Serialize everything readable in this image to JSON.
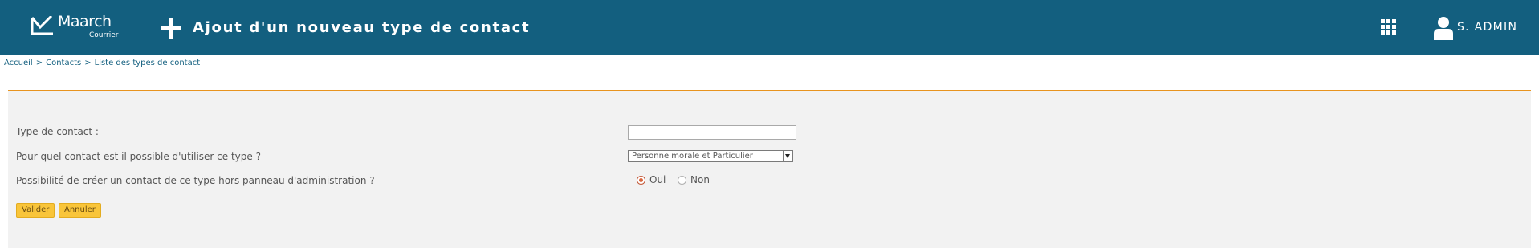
{
  "header": {
    "logo_name": "Maarch",
    "logo_sub": "Courrier",
    "page_title": "Ajout d'un nouveau type de contact",
    "user_name": "S. ADMIN",
    "icons": {
      "add": "plus-icon",
      "apps": "apps-grid-icon",
      "user": "user-icon"
    },
    "colors": {
      "background": "#135f7f",
      "text": "#ffffff"
    }
  },
  "breadcrumb": {
    "items": [
      "Accueil",
      "Contacts",
      "Liste des types de contact"
    ],
    "separator": ">"
  },
  "form": {
    "type_label": "Type de contact :",
    "type_value": "",
    "usage_label": "Pour quel contact est il possible d'utiliser ce type ?",
    "usage_value": "Personne morale et Particulier",
    "outside_admin_label": "Possibilité de créer un contact de ce type hors panneau d'administration ?",
    "outside_admin_options": [
      {
        "label": "Oui",
        "checked": true
      },
      {
        "label": "Non",
        "checked": false
      }
    ],
    "submit_label": "Valider",
    "cancel_label": "Annuler"
  },
  "colors": {
    "accent_line": "#e8941f",
    "button": "#f9c53a",
    "panel": "#f2f2f2"
  }
}
